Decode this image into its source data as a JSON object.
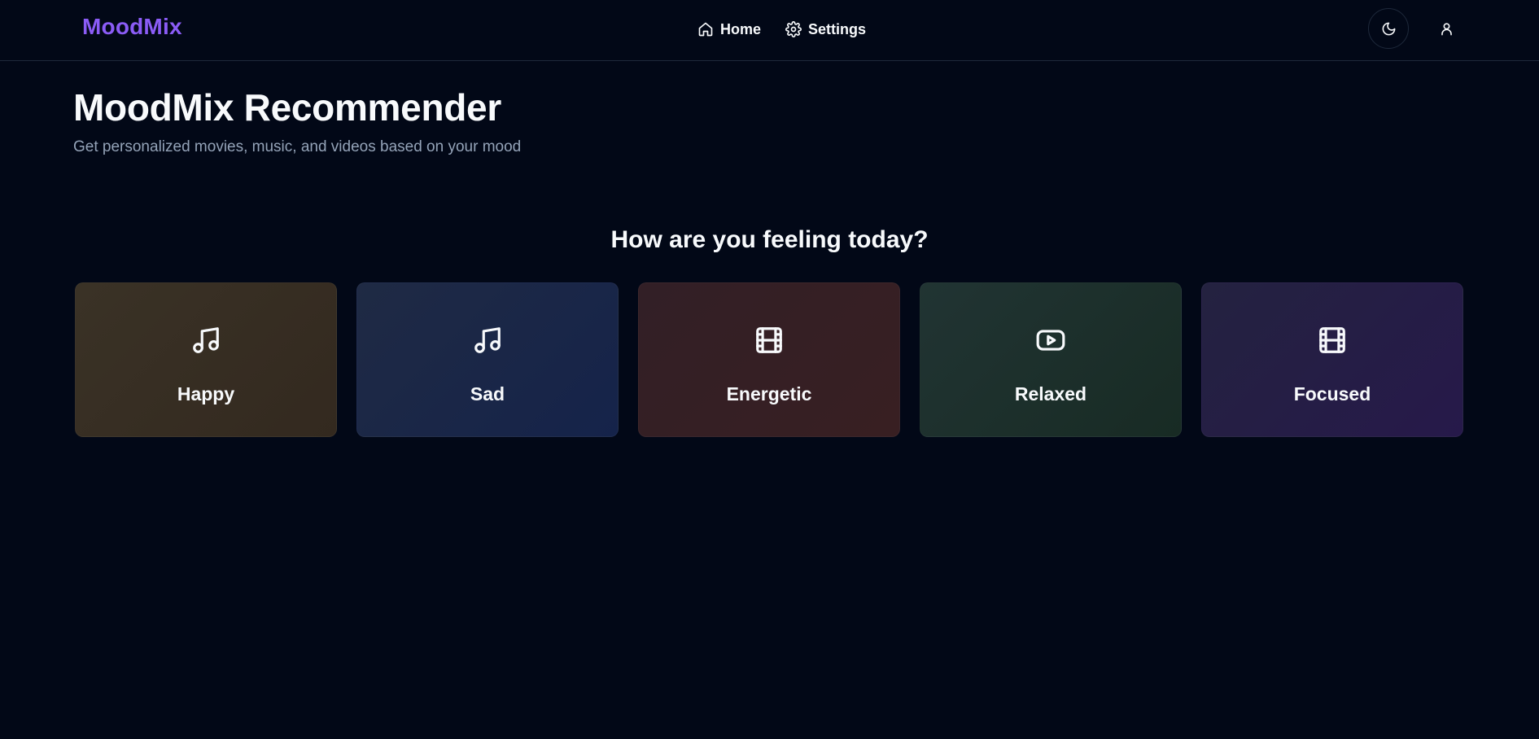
{
  "header": {
    "brand": "MoodMix",
    "nav": [
      {
        "label": "Home",
        "icon": "home-icon"
      },
      {
        "label": "Settings",
        "icon": "gear-icon"
      }
    ],
    "actions": [
      {
        "icon": "moon-icon"
      },
      {
        "icon": "user-icon"
      }
    ]
  },
  "main": {
    "title": "MoodMix Recommender",
    "subtitle": "Get personalized movies, music, and videos based on your mood",
    "question": "How are you feeling today?",
    "moods": [
      {
        "label": "Happy",
        "icon": "music-note-icon"
      },
      {
        "label": "Sad",
        "icon": "music-note-icon"
      },
      {
        "label": "Energetic",
        "icon": "film-icon"
      },
      {
        "label": "Relaxed",
        "icon": "youtube-icon"
      },
      {
        "label": "Focused",
        "icon": "film-icon"
      }
    ]
  },
  "colors": {
    "background": "#020817",
    "brand": "#8b5cf6",
    "text": "#f8fafc",
    "muted": "#94a3b8",
    "border": "#1e293b"
  }
}
